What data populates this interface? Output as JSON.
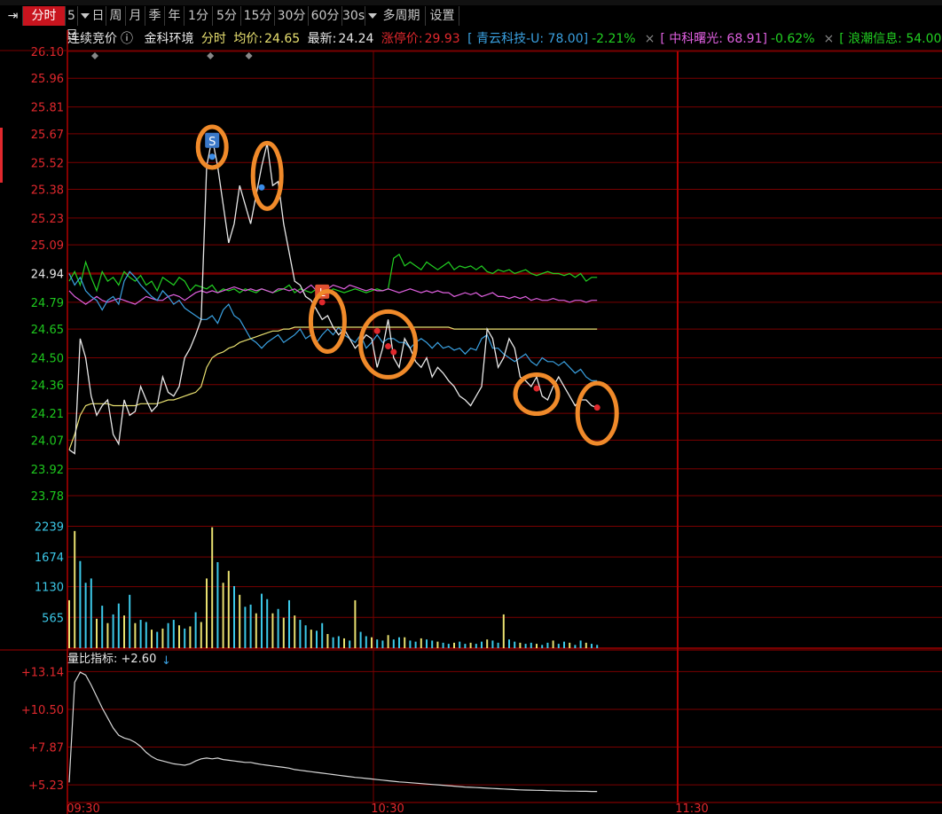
{
  "toolbar": {
    "items": [
      {
        "label": "分时",
        "active": true
      },
      {
        "label": "5日",
        "active": false,
        "caret": true
      },
      {
        "label": "日",
        "active": false
      },
      {
        "label": "周",
        "active": false
      },
      {
        "label": "月",
        "active": false
      },
      {
        "label": "季",
        "active": false
      },
      {
        "label": "年",
        "active": false
      },
      {
        "label": "1分",
        "active": false
      },
      {
        "label": "5分",
        "active": false
      },
      {
        "label": "15分",
        "active": false
      },
      {
        "label": "30分",
        "active": false
      },
      {
        "label": "60分",
        "active": false
      },
      {
        "label": "30s",
        "active": false,
        "caret": true
      },
      {
        "label": "多周期",
        "active": false
      },
      {
        "label": "设置",
        "active": false
      }
    ]
  },
  "infobar": {
    "mode": "连续竞价",
    "info_icon": "ⓘ",
    "stock_name": "金科环境",
    "period": "分时",
    "avg_label": "均价:",
    "avg_value": "24.65",
    "last_label": "最新:",
    "last_value": "24.24",
    "limit_label": "涨停价:",
    "limit_value": "29.93",
    "compare": [
      {
        "text": "[ 青云科技-U: 78.00]",
        "change": "-2.21%",
        "color": "#3aa0e0",
        "change_color": "#22d022"
      },
      {
        "text": "[ 中科曙光: 68.91]",
        "change": "-0.62%",
        "color": "#e060e0",
        "change_color": "#22d022"
      },
      {
        "text": "[ 浪潮信息: 54.00",
        "change": "",
        "color": "#22d022",
        "change_color": "#22d022"
      }
    ],
    "close_glyph": "×"
  },
  "colors": {
    "up": "#e0282d",
    "down": "#1ec81e",
    "grid": "#7a0000",
    "price": "#e8e8e8",
    "avg": "#e8e070",
    "vol_up": "#e8e070",
    "vol_down": "#3cc8e8",
    "marker_ring": "#f08a2a"
  },
  "indicator": {
    "label": "量比指标:",
    "value": "+2.60",
    "arrow": "↓"
  },
  "chart_data": {
    "type": "line",
    "price_axis": {
      "ticks": [
        "26.10",
        "25.96",
        "25.81",
        "25.67",
        "25.52",
        "25.38",
        "25.23",
        "25.09",
        "24.94",
        "24.79",
        "24.65",
        "24.50",
        "24.36",
        "24.21",
        "24.07",
        "23.92",
        "23.78"
      ],
      "prev_close": 24.94,
      "ylim": [
        23.78,
        26.1
      ]
    },
    "volume_axis": {
      "ticks": [
        "2239",
        "1674",
        "1130",
        "565"
      ]
    },
    "ratio_axis": {
      "ticks": [
        "+13.14",
        "+10.50",
        "+7.87",
        "+5.23"
      ]
    },
    "x_labels": [
      "09:30",
      "10:30",
      "11:30"
    ],
    "series": [
      {
        "key": "price",
        "values": [
          24.02,
          24.0,
          24.6,
          24.5,
          24.3,
          24.2,
          24.25,
          24.28,
          24.1,
          24.05,
          24.28,
          24.2,
          24.22,
          24.35,
          24.28,
          24.22,
          24.25,
          24.4,
          24.32,
          24.3,
          24.35,
          24.5,
          24.55,
          24.62,
          24.7,
          25.5,
          25.65,
          25.5,
          25.3,
          25.1,
          25.2,
          25.4,
          25.3,
          25.2,
          25.35,
          25.5,
          25.62,
          25.4,
          25.42,
          25.2,
          25.05,
          24.9,
          24.88,
          24.82,
          24.8,
          24.75,
          24.7,
          24.72,
          24.66,
          24.62,
          24.65,
          24.6,
          24.55,
          24.58,
          24.62,
          24.6,
          24.45,
          24.55,
          24.7,
          24.5,
          24.45,
          24.6,
          24.55,
          24.48,
          24.45,
          24.5,
          24.4,
          24.45,
          24.42,
          24.38,
          24.35,
          24.3,
          24.28,
          24.25,
          24.3,
          24.35,
          24.65,
          24.6,
          24.45,
          24.5,
          24.6,
          24.55,
          24.4,
          24.38,
          24.35,
          24.4,
          24.3,
          24.28,
          24.35,
          24.4,
          24.35,
          24.3,
          24.25,
          24.28,
          24.28,
          24.25,
          24.24
        ]
      },
      {
        "key": "avg",
        "values": [
          24.02,
          24.1,
          24.2,
          24.25,
          24.26,
          24.26,
          24.26,
          24.26,
          24.25,
          24.25,
          24.25,
          24.25,
          24.25,
          24.26,
          24.26,
          24.26,
          24.26,
          24.27,
          24.28,
          24.28,
          24.29,
          24.3,
          24.31,
          24.32,
          24.35,
          24.45,
          24.5,
          24.52,
          24.53,
          24.55,
          24.56,
          24.58,
          24.59,
          24.6,
          24.61,
          24.62,
          24.63,
          24.64,
          24.64,
          24.65,
          24.65,
          24.66,
          24.66,
          24.66,
          24.66,
          24.66,
          24.66,
          24.66,
          24.66,
          24.66,
          24.66,
          24.66,
          24.66,
          24.66,
          24.66,
          24.66,
          24.66,
          24.66,
          24.66,
          24.66,
          24.66,
          24.66,
          24.66,
          24.66,
          24.66,
          24.66,
          24.66,
          24.66,
          24.66,
          24.66,
          24.65,
          24.65,
          24.65,
          24.65,
          24.65,
          24.65,
          24.65,
          24.65,
          24.65,
          24.65,
          24.65,
          24.65,
          24.65,
          24.65,
          24.65,
          24.65,
          24.65,
          24.65,
          24.65,
          24.65,
          24.65,
          24.65,
          24.65,
          24.65,
          24.65,
          24.65,
          24.65
        ]
      },
      {
        "key": "qingyun",
        "values": [
          24.94,
          24.88,
          24.92,
          24.85,
          24.82,
          24.8,
          24.75,
          24.8,
          24.82,
          24.78,
          24.9,
          24.95,
          24.92,
          24.88,
          24.85,
          24.82,
          24.8,
          24.85,
          24.82,
          24.78,
          24.8,
          24.76,
          24.74,
          24.72,
          24.7,
          24.7,
          24.72,
          24.68,
          24.75,
          24.78,
          24.72,
          24.7,
          24.65,
          24.6,
          24.58,
          24.55,
          24.58,
          24.6,
          24.62,
          24.58,
          24.6,
          24.62,
          24.65,
          24.6,
          24.62,
          24.58,
          24.62,
          24.65,
          24.62,
          24.66,
          24.62,
          24.6,
          24.58,
          24.62,
          24.55,
          24.58,
          24.62,
          24.58,
          24.6,
          24.6,
          24.58,
          24.58,
          24.55,
          24.58,
          24.6,
          24.58,
          24.55,
          24.58,
          24.55,
          24.56,
          24.54,
          24.55,
          24.52,
          24.55,
          24.54,
          24.6,
          24.62,
          24.55,
          24.55,
          24.52,
          24.5,
          24.48,
          24.5,
          24.52,
          24.48,
          24.46,
          24.5,
          24.48,
          24.48,
          24.46,
          24.48,
          24.45,
          24.42,
          24.44,
          24.4,
          24.38,
          24.38
        ]
      },
      {
        "key": "zhongke",
        "values": [
          24.85,
          24.82,
          24.8,
          24.78,
          24.8,
          24.82,
          24.8,
          24.79,
          24.8,
          24.81,
          24.8,
          24.79,
          24.78,
          24.8,
          24.82,
          24.81,
          24.8,
          24.8,
          24.82,
          24.83,
          24.82,
          24.8,
          24.82,
          24.84,
          24.85,
          24.84,
          24.85,
          24.84,
          24.85,
          24.86,
          24.87,
          24.86,
          24.85,
          24.86,
          24.85,
          24.86,
          24.85,
          24.84,
          24.86,
          24.86,
          24.85,
          24.86,
          24.84,
          24.86,
          24.88,
          24.85,
          24.84,
          24.86,
          24.88,
          24.87,
          24.86,
          24.88,
          24.87,
          24.86,
          24.85,
          24.86,
          24.85,
          24.85,
          24.86,
          24.85,
          24.84,
          24.85,
          24.86,
          24.85,
          24.84,
          24.85,
          24.84,
          24.85,
          24.84,
          24.84,
          24.82,
          24.83,
          24.84,
          24.83,
          24.84,
          24.82,
          24.83,
          24.84,
          24.82,
          24.82,
          24.81,
          24.82,
          24.81,
          24.82,
          24.8,
          24.81,
          24.8,
          24.8,
          24.81,
          24.8,
          24.8,
          24.79,
          24.8,
          24.8,
          24.79,
          24.8,
          24.8
        ]
      },
      {
        "key": "langchao",
        "values": [
          24.9,
          24.95,
          24.88,
          25.0,
          24.92,
          24.85,
          24.95,
          24.9,
          24.92,
          24.88,
          24.95,
          24.92,
          24.9,
          24.93,
          24.88,
          24.9,
          24.85,
          24.92,
          24.9,
          24.88,
          24.92,
          24.9,
          24.85,
          24.88,
          24.87,
          24.86,
          24.88,
          24.84,
          24.86,
          24.85,
          24.86,
          24.84,
          24.86,
          24.85,
          24.84,
          24.86,
          24.85,
          24.84,
          24.85,
          24.86,
          24.88,
          24.84,
          24.86,
          24.85,
          24.84,
          24.86,
          24.85,
          24.84,
          24.86,
          24.85,
          24.84,
          24.85,
          24.86,
          24.85,
          24.84,
          24.85,
          24.86,
          24.85,
          24.86,
          25.02,
          25.04,
          24.98,
          25.0,
          24.98,
          24.96,
          25.0,
          24.98,
          24.96,
          24.98,
          25.0,
          24.96,
          24.98,
          24.97,
          24.98,
          24.96,
          24.98,
          24.95,
          24.94,
          24.96,
          24.95,
          24.96,
          24.94,
          24.95,
          24.96,
          24.94,
          24.93,
          24.94,
          24.95,
          24.94,
          24.94,
          24.93,
          24.94,
          24.92,
          24.94,
          24.9,
          24.92,
          24.92
        ]
      }
    ],
    "volume": [
      880,
      2150,
      1600,
      1200,
      1280,
      540,
      780,
      460,
      620,
      820,
      600,
      980,
      460,
      520,
      480,
      340,
      300,
      360,
      460,
      520,
      420,
      360,
      400,
      660,
      480,
      1280,
      2220,
      1580,
      1200,
      1420,
      1140,
      980,
      760,
      800,
      640,
      1000,
      900,
      640,
      720,
      560,
      880,
      600,
      520,
      420,
      340,
      320,
      460,
      260,
      200,
      220,
      180,
      140,
      880,
      300,
      220,
      200,
      160,
      140,
      240,
      160,
      200,
      200,
      140,
      120,
      180,
      160,
      140,
      120,
      100,
      80,
      100,
      120,
      80,
      100,
      80,
      120,
      160,
      140,
      100,
      620,
      160,
      120,
      100,
      80,
      100,
      80,
      60,
      100,
      140,
      80,
      120,
      100,
      60,
      140,
      100,
      80,
      60
    ],
    "volume_up": [
      1,
      1,
      0,
      0,
      0,
      1,
      0,
      1,
      0,
      0,
      1,
      0,
      1,
      0,
      0,
      1,
      0,
      1,
      0,
      0,
      1,
      0,
      1,
      0,
      1,
      1,
      1,
      0,
      1,
      1,
      0,
      1,
      0,
      0,
      1,
      0,
      0,
      1,
      0,
      1,
      0,
      1,
      0,
      0,
      1,
      0,
      0,
      1,
      0,
      0,
      1,
      0,
      1,
      0,
      0,
      1,
      0,
      0,
      1,
      0,
      0,
      1,
      0,
      0,
      1,
      0,
      0,
      1,
      0,
      0,
      1,
      0,
      0,
      1,
      0,
      0,
      1,
      0,
      0,
      1,
      0,
      0,
      1,
      0,
      0,
      1,
      0,
      0,
      1,
      0,
      0,
      1,
      0,
      0,
      1,
      0,
      0
    ],
    "ratio": [
      5.4,
      12.4,
      13.1,
      12.9,
      12.2,
      11.4,
      10.6,
      9.9,
      9.2,
      8.7,
      8.5,
      8.4,
      8.2,
      7.9,
      7.5,
      7.2,
      7.0,
      6.9,
      6.8,
      6.7,
      6.65,
      6.6,
      6.7,
      6.9,
      7.05,
      7.1,
      7.05,
      7.1,
      7.0,
      6.95,
      6.9,
      6.85,
      6.8,
      6.8,
      6.72,
      6.65,
      6.6,
      6.55,
      6.5,
      6.45,
      6.4,
      6.3,
      6.25,
      6.2,
      6.15,
      6.1,
      6.05,
      6.0,
      5.95,
      5.9,
      5.85,
      5.8,
      5.75,
      5.72,
      5.68,
      5.64,
      5.6,
      5.56,
      5.52,
      5.48,
      5.44,
      5.41,
      5.38,
      5.35,
      5.32,
      5.29,
      5.26,
      5.23,
      5.2,
      5.17,
      5.14,
      5.11,
      5.08,
      5.06,
      5.04,
      5.02,
      5.0,
      4.98,
      4.96,
      4.94,
      4.92,
      4.9,
      4.88,
      4.87,
      4.86,
      4.85,
      4.84,
      4.83,
      4.82,
      4.81,
      4.8,
      4.79,
      4.79,
      4.78,
      4.78,
      4.77,
      4.77
    ],
    "buy_marks": [
      {
        "label": "S",
        "i": 26,
        "v": 25.55
      },
      {
        "label": "",
        "i": 35,
        "v": 25.39
      }
    ],
    "sell_marks": [
      {
        "label": "L",
        "i": 46,
        "v": 24.79
      },
      {
        "label": "",
        "i": 56,
        "v": 24.64
      },
      {
        "label": "",
        "i": 58,
        "v": 24.56
      },
      {
        "label": "",
        "i": 59,
        "v": 24.53
      },
      {
        "label": "",
        "i": 85,
        "v": 24.34
      },
      {
        "label": "",
        "i": 96,
        "v": 24.24
      }
    ],
    "diamonds": [
      5,
      26,
      33
    ],
    "highlight_rings": [
      {
        "i": 26,
        "v": 25.6,
        "rx": 16,
        "ry": 23
      },
      {
        "i": 36,
        "v": 25.45,
        "rx": 16,
        "ry": 37
      },
      {
        "i": 47,
        "v": 24.69,
        "rx": 19,
        "ry": 34
      },
      {
        "i": 58,
        "v": 24.57,
        "rx": 31,
        "ry": 37
      },
      {
        "i": 85,
        "v": 24.31,
        "rx": 24,
        "ry": 22
      },
      {
        "i": 96,
        "v": 24.21,
        "rx": 22,
        "ry": 34
      }
    ]
  }
}
